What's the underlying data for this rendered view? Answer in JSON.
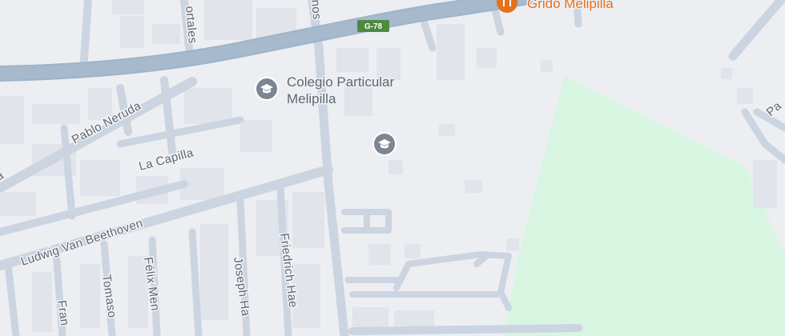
{
  "map": {
    "colors": {
      "background": "#eceef2",
      "highway": "#9fb3c9",
      "street": "#cbd4e0",
      "park": "#d8f5e2",
      "education_poi": "#7b8692",
      "food_poi": "#e5711f",
      "route_shield": "#4d8a3f"
    },
    "route_shield": {
      "label": "G-78"
    },
    "pois": [
      {
        "name": "Colegio Particular",
        "name_line2": "Melipilla",
        "icon": "graduation-cap-icon"
      },
      {
        "icon": "graduation-cap-icon"
      },
      {
        "name": "Grido Melipilla",
        "icon": "restaurant-icon"
      }
    ],
    "streets": [
      {
        "name": "Pablo Neruda"
      },
      {
        "name": "La Capilla"
      },
      {
        "name": "Ludwig Van Beethoven"
      },
      {
        "name": "Friedrich Hae"
      },
      {
        "name": "Joseph Ha"
      },
      {
        "name": "Félix Men"
      },
      {
        "name": "Tomaso"
      },
      {
        "name": "Fran"
      },
      {
        "name": "ortales"
      },
      {
        "name": "nos"
      },
      {
        "name": "ao"
      },
      {
        "name": "a"
      },
      {
        "name": "Pa"
      }
    ]
  }
}
